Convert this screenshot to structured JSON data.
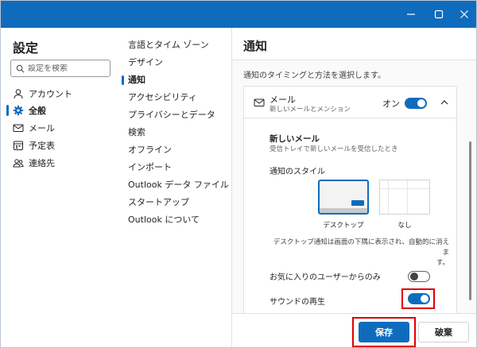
{
  "window": {
    "controls": {
      "minimize_icon": "minimize-icon",
      "maximize_icon": "maximize-icon",
      "close_icon": "close-icon"
    },
    "accent_color": "#0f6cbd",
    "highlight_color": "#e00000"
  },
  "sidebar": {
    "title": "設定",
    "search_placeholder": "設定を検索",
    "items": [
      {
        "label": "アカウント",
        "icon": "person-icon",
        "active": false
      },
      {
        "label": "全般",
        "icon": "gear-icon",
        "active": true
      },
      {
        "label": "メール",
        "icon": "mail-icon",
        "active": false
      },
      {
        "label": "予定表",
        "icon": "calendar-icon",
        "active": false
      },
      {
        "label": "連絡先",
        "icon": "contacts-icon",
        "active": false
      }
    ]
  },
  "subnav": {
    "items": [
      {
        "label": "言語とタイム ゾーン",
        "active": false
      },
      {
        "label": "デザイン",
        "active": false
      },
      {
        "label": "通知",
        "active": true
      },
      {
        "label": "アクセシビリティ",
        "active": false
      },
      {
        "label": "プライバシーとデータ",
        "active": false
      },
      {
        "label": "検索",
        "active": false
      },
      {
        "label": "オフライン",
        "active": false
      },
      {
        "label": "インポート",
        "active": false
      },
      {
        "label": "Outlook データ ファイル",
        "active": false
      },
      {
        "label": "スタートアップ",
        "active": false
      },
      {
        "label": "Outlook について",
        "active": false
      }
    ]
  },
  "pane": {
    "title": "通知",
    "description": "通知のタイミングと方法を選択します。",
    "mail_card": {
      "title": "メール",
      "subtitle": "新しいメールとメンション",
      "toggle_label": "オン",
      "toggle_on": true,
      "new_mail_title": "新しいメール",
      "new_mail_sub": "受信トレイで新しいメールを受信したとき",
      "style_label": "通知のスタイル",
      "style_options": [
        {
          "label": "デスクトップ",
          "selected": true
        },
        {
          "label": "なし",
          "selected": false
        }
      ],
      "desktop_note_line1": "デスクトップ通知は画面の下隅に表示され、自動的に消えま",
      "desktop_note_line2": "す。",
      "favorites_label": "お気に入りのユーザーからのみ",
      "favorites_on": false,
      "sound_label": "サウンドの再生",
      "sound_on": true
    }
  },
  "footer": {
    "save_label": "保存",
    "discard_label": "破棄"
  }
}
